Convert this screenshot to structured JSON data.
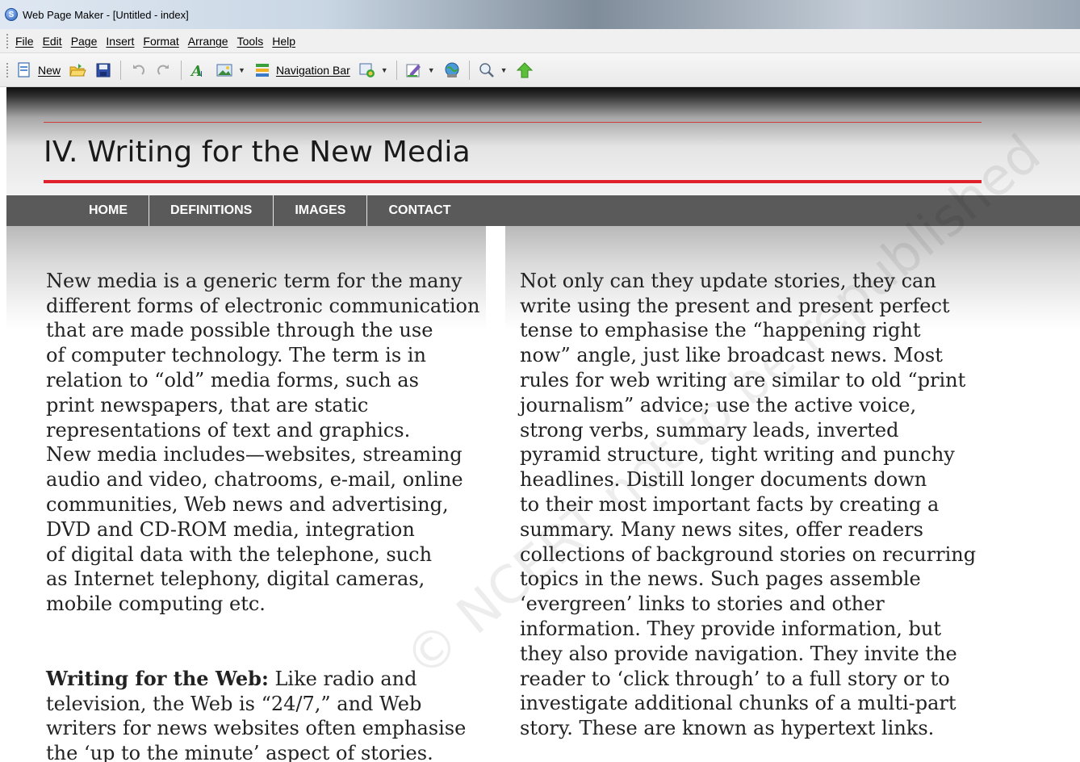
{
  "window": {
    "title": "Web Page Maker - [Untitled - index]"
  },
  "menu": {
    "items": [
      "File",
      "Edit",
      "Page",
      "Insert",
      "Format",
      "Arrange",
      "Tools",
      "Help"
    ]
  },
  "toolbar": {
    "new_label": "New",
    "navbar_label": "Navigation Bar",
    "icons": [
      "new-page-icon",
      "open-folder-icon",
      "save-icon",
      "undo-icon",
      "redo-icon",
      "text-icon",
      "image-icon",
      "navigation-bar-icon",
      "shape-icon",
      "edit-icon",
      "globe-publish-icon",
      "zoom-icon",
      "up-arrow-icon"
    ]
  },
  "page": {
    "title": "IV. Writing for the New Media",
    "nav": [
      "HOME",
      "DEFINITIONS",
      "IMAGES",
      "CONTACT"
    ],
    "left_para1": "New media is a generic term for the many\ndifferent forms of electronic communication\nthat are made possible through the use\nof computer technology. The term is in\nrelation to “old” media forms, such as\nprint newspapers, that are static\nrepresentations of text and graphics.\nNew media includes—websites, streaming\naudio and video, chatrooms, e-mail, online\ncommunities, Web news and advertising,\nDVD and CD-ROM media, integration\nof digital data with the telephone, such\nas Internet telephony, digital cameras,\nmobile computing etc.",
    "left_para2_lead": "Writing for the Web:",
    "left_para2_body": " Like radio and\ntelevision, the Web is “24/7,” and Web\nwriters for news websites often emphasise\nthe ‘up to the minute’ aspect of stories.",
    "right_para": "Not only can they update stories, they can\nwrite using the present and present perfect\ntense to emphasise the “happening right\nnow” angle, just like broadcast news. Most\nrules for web writing are similar to old “print\njournalism” advice; use the active voice,\nstrong verbs, summary leads, inverted\npyramid structure, tight writing and punchy\nheadlines. Distill longer documents down\nto their most important facts by creating a\nsummary. Many news sites, offer readers\ncollections of background stories on recurring\ntopics in the news. Such pages assemble\n‘evergreen’ links to stories and other\ninformation. They provide information, but\nthey also provide navigation. They invite the\nreader to ‘click through’ to a full story or to\ninvestigate additional chunks of a multi-part\nstory. These are known as hypertext links.",
    "watermark": "© NCERT not to be republished"
  },
  "colors": {
    "accent_red": "#e0202b",
    "nav_bg": "#5a5a5a"
  }
}
